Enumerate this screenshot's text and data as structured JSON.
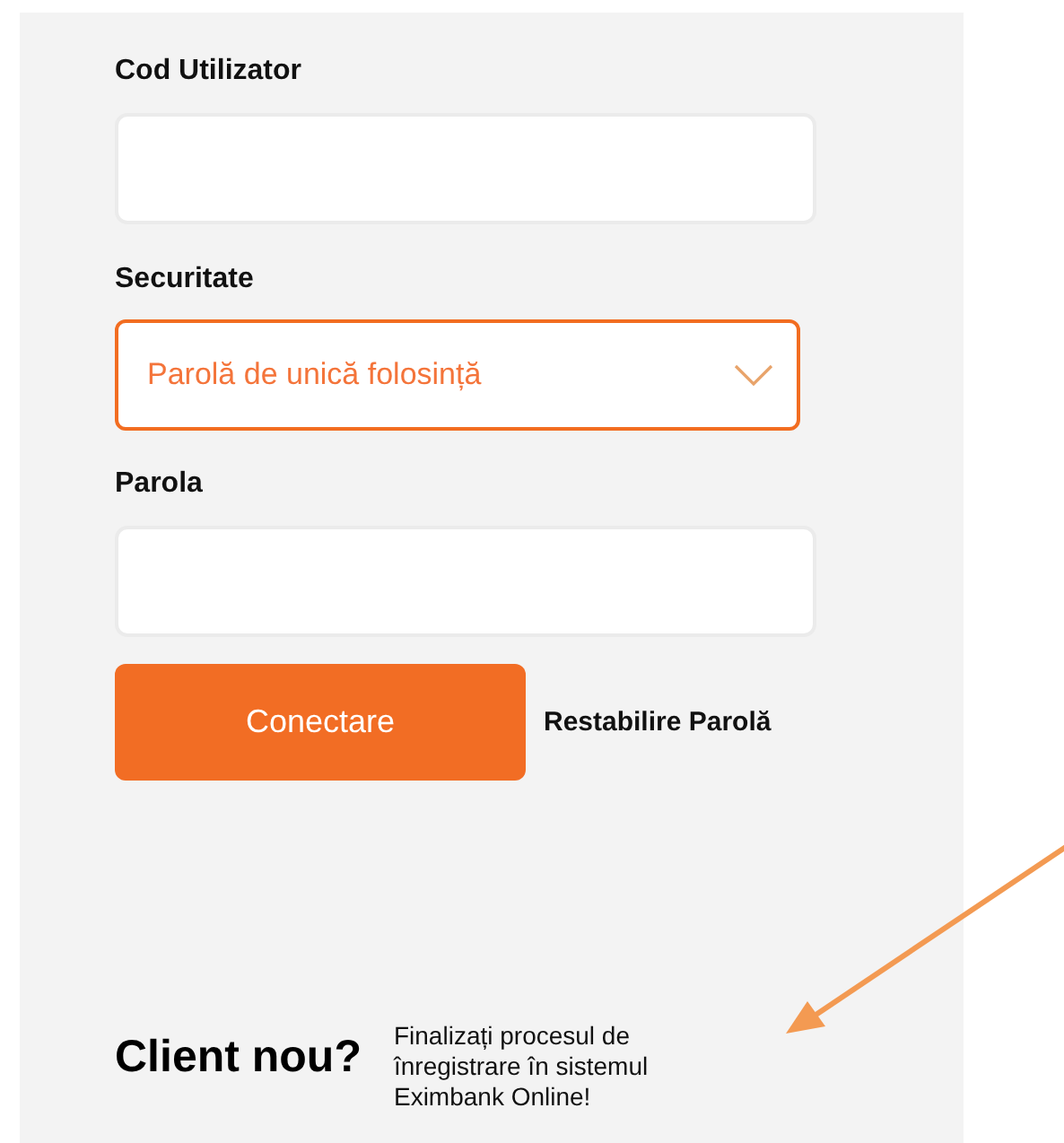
{
  "login_form": {
    "fields": [
      {
        "kind": "text",
        "label": "Cod Utilizator"
      },
      {
        "kind": "select",
        "label": "Securitate",
        "value": "Parolă de unică folosință"
      },
      {
        "kind": "text",
        "label": "Parola"
      }
    ],
    "connect_button": "Conectare",
    "reset_link": "Restabilire Parolă"
  },
  "new_client": {
    "heading": "Client nou?",
    "text": "Finalizați procesul de înregistrare în sistemul Eximbank Online!"
  }
}
